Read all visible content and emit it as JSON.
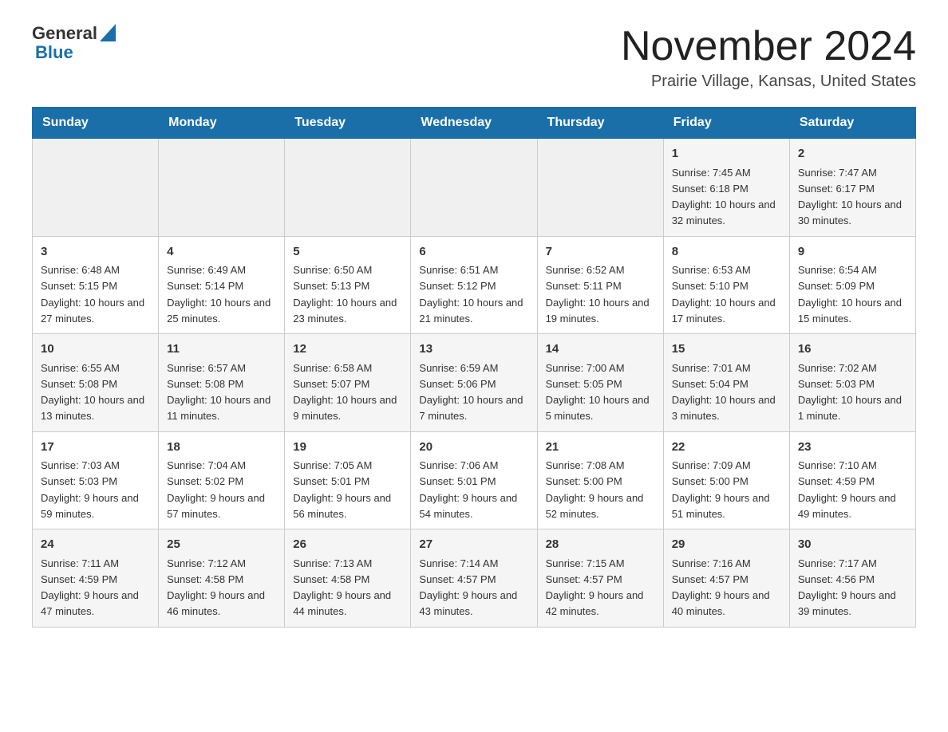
{
  "header": {
    "logo": {
      "text_general": "General",
      "text_blue": "Blue"
    },
    "title": "November 2024",
    "location": "Prairie Village, Kansas, United States"
  },
  "calendar": {
    "days_of_week": [
      "Sunday",
      "Monday",
      "Tuesday",
      "Wednesday",
      "Thursday",
      "Friday",
      "Saturday"
    ],
    "rows": [
      {
        "cells": [
          {
            "day": "",
            "info": ""
          },
          {
            "day": "",
            "info": ""
          },
          {
            "day": "",
            "info": ""
          },
          {
            "day": "",
            "info": ""
          },
          {
            "day": "",
            "info": ""
          },
          {
            "day": "1",
            "info": "Sunrise: 7:45 AM\nSunset: 6:18 PM\nDaylight: 10 hours and 32 minutes."
          },
          {
            "day": "2",
            "info": "Sunrise: 7:47 AM\nSunset: 6:17 PM\nDaylight: 10 hours and 30 minutes."
          }
        ]
      },
      {
        "cells": [
          {
            "day": "3",
            "info": "Sunrise: 6:48 AM\nSunset: 5:15 PM\nDaylight: 10 hours and 27 minutes."
          },
          {
            "day": "4",
            "info": "Sunrise: 6:49 AM\nSunset: 5:14 PM\nDaylight: 10 hours and 25 minutes."
          },
          {
            "day": "5",
            "info": "Sunrise: 6:50 AM\nSunset: 5:13 PM\nDaylight: 10 hours and 23 minutes."
          },
          {
            "day": "6",
            "info": "Sunrise: 6:51 AM\nSunset: 5:12 PM\nDaylight: 10 hours and 21 minutes."
          },
          {
            "day": "7",
            "info": "Sunrise: 6:52 AM\nSunset: 5:11 PM\nDaylight: 10 hours and 19 minutes."
          },
          {
            "day": "8",
            "info": "Sunrise: 6:53 AM\nSunset: 5:10 PM\nDaylight: 10 hours and 17 minutes."
          },
          {
            "day": "9",
            "info": "Sunrise: 6:54 AM\nSunset: 5:09 PM\nDaylight: 10 hours and 15 minutes."
          }
        ]
      },
      {
        "cells": [
          {
            "day": "10",
            "info": "Sunrise: 6:55 AM\nSunset: 5:08 PM\nDaylight: 10 hours and 13 minutes."
          },
          {
            "day": "11",
            "info": "Sunrise: 6:57 AM\nSunset: 5:08 PM\nDaylight: 10 hours and 11 minutes."
          },
          {
            "day": "12",
            "info": "Sunrise: 6:58 AM\nSunset: 5:07 PM\nDaylight: 10 hours and 9 minutes."
          },
          {
            "day": "13",
            "info": "Sunrise: 6:59 AM\nSunset: 5:06 PM\nDaylight: 10 hours and 7 minutes."
          },
          {
            "day": "14",
            "info": "Sunrise: 7:00 AM\nSunset: 5:05 PM\nDaylight: 10 hours and 5 minutes."
          },
          {
            "day": "15",
            "info": "Sunrise: 7:01 AM\nSunset: 5:04 PM\nDaylight: 10 hours and 3 minutes."
          },
          {
            "day": "16",
            "info": "Sunrise: 7:02 AM\nSunset: 5:03 PM\nDaylight: 10 hours and 1 minute."
          }
        ]
      },
      {
        "cells": [
          {
            "day": "17",
            "info": "Sunrise: 7:03 AM\nSunset: 5:03 PM\nDaylight: 9 hours and 59 minutes."
          },
          {
            "day": "18",
            "info": "Sunrise: 7:04 AM\nSunset: 5:02 PM\nDaylight: 9 hours and 57 minutes."
          },
          {
            "day": "19",
            "info": "Sunrise: 7:05 AM\nSunset: 5:01 PM\nDaylight: 9 hours and 56 minutes."
          },
          {
            "day": "20",
            "info": "Sunrise: 7:06 AM\nSunset: 5:01 PM\nDaylight: 9 hours and 54 minutes."
          },
          {
            "day": "21",
            "info": "Sunrise: 7:08 AM\nSunset: 5:00 PM\nDaylight: 9 hours and 52 minutes."
          },
          {
            "day": "22",
            "info": "Sunrise: 7:09 AM\nSunset: 5:00 PM\nDaylight: 9 hours and 51 minutes."
          },
          {
            "day": "23",
            "info": "Sunrise: 7:10 AM\nSunset: 4:59 PM\nDaylight: 9 hours and 49 minutes."
          }
        ]
      },
      {
        "cells": [
          {
            "day": "24",
            "info": "Sunrise: 7:11 AM\nSunset: 4:59 PM\nDaylight: 9 hours and 47 minutes."
          },
          {
            "day": "25",
            "info": "Sunrise: 7:12 AM\nSunset: 4:58 PM\nDaylight: 9 hours and 46 minutes."
          },
          {
            "day": "26",
            "info": "Sunrise: 7:13 AM\nSunset: 4:58 PM\nDaylight: 9 hours and 44 minutes."
          },
          {
            "day": "27",
            "info": "Sunrise: 7:14 AM\nSunset: 4:57 PM\nDaylight: 9 hours and 43 minutes."
          },
          {
            "day": "28",
            "info": "Sunrise: 7:15 AM\nSunset: 4:57 PM\nDaylight: 9 hours and 42 minutes."
          },
          {
            "day": "29",
            "info": "Sunrise: 7:16 AM\nSunset: 4:57 PM\nDaylight: 9 hours and 40 minutes."
          },
          {
            "day": "30",
            "info": "Sunrise: 7:17 AM\nSunset: 4:56 PM\nDaylight: 9 hours and 39 minutes."
          }
        ]
      }
    ]
  }
}
